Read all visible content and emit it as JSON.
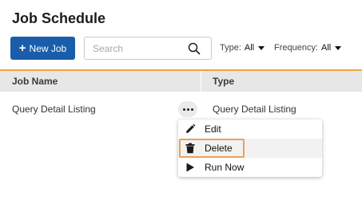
{
  "page": {
    "title": "Job Schedule"
  },
  "toolbar": {
    "new_job": {
      "plus": "+",
      "label": "New Job"
    },
    "search": {
      "placeholder": "Search"
    },
    "filters": {
      "type": {
        "label": "Type:",
        "value": "All"
      },
      "frequency": {
        "label": "Frequency:",
        "value": "All"
      }
    }
  },
  "table": {
    "columns": [
      "Job Name",
      "Type"
    ],
    "rows": [
      {
        "name": "Query Detail Listing",
        "type": "Query Detail Listing"
      }
    ]
  },
  "context_menu": {
    "items": [
      {
        "label": "Edit",
        "icon": "pencil-icon"
      },
      {
        "label": "Delete",
        "icon": "trash-icon"
      },
      {
        "label": "Run Now",
        "icon": "play-icon"
      }
    ],
    "highlighted_item": "Delete"
  },
  "colors": {
    "primary": "#1a5dab",
    "accent": "#f0a33c",
    "highlight_border": "#e8a258",
    "header_bg": "#e7e7e7"
  }
}
